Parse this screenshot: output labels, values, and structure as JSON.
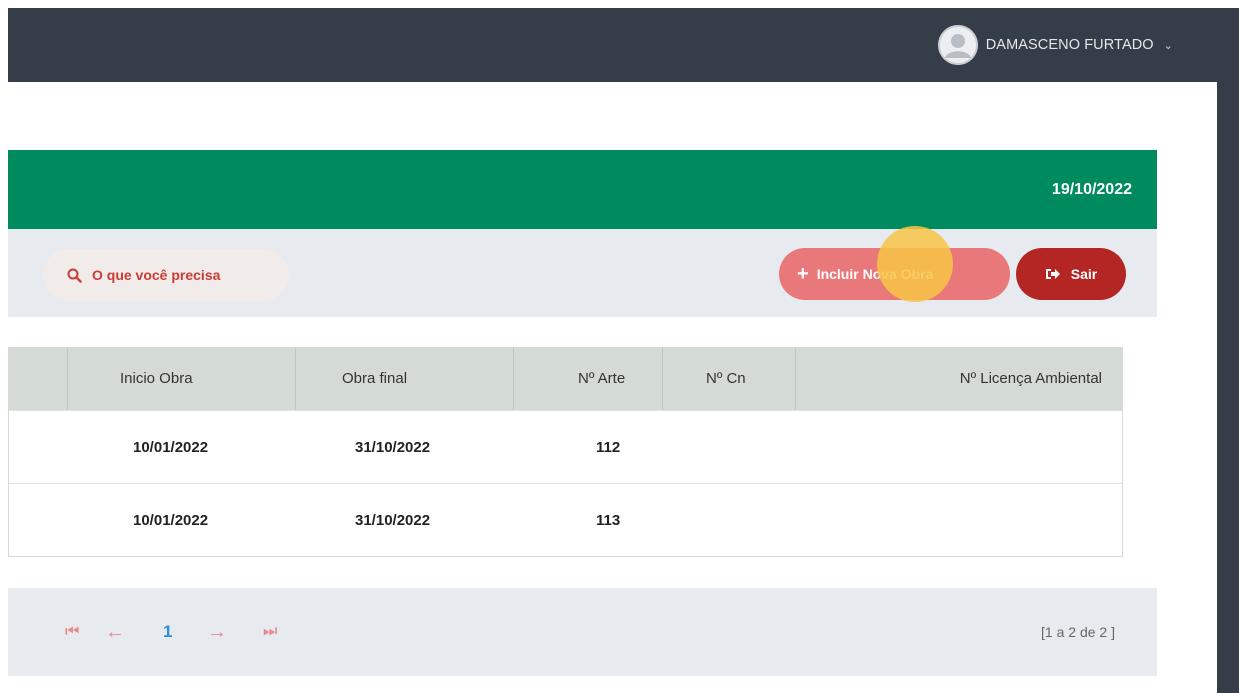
{
  "header": {
    "user_name": "DAMASCENO FURTADO",
    "user_menu_chevron": "⌄"
  },
  "banner": {
    "date": "19/10/2022",
    "color": "#008b5e"
  },
  "toolbar": {
    "search_label": "O que você precisa",
    "new_button_label": "Incluir Nova Obra",
    "exit_button_label": "Sair",
    "new_button_color": "#e9787a",
    "exit_button_color": "#b32623"
  },
  "table": {
    "headers": {
      "inicio": "Inicio Obra",
      "final": "Obra final",
      "arte": "Nº Arte",
      "cn": "Nº Cn",
      "licenca": "Nº Licença Ambiental"
    },
    "rows": [
      {
        "inicio": "10/01/2022",
        "final": "31/10/2022",
        "arte": "112",
        "cn": "",
        "licenca": ""
      },
      {
        "inicio": "10/01/2022",
        "final": "31/10/2022",
        "arte": "113",
        "cn": "",
        "licenca": ""
      }
    ]
  },
  "pagination": {
    "first": "⏮",
    "prev": "←",
    "current_page": "1",
    "next": "→",
    "last": "⏭",
    "count_text": "[1 a 2 de 2 ]"
  },
  "icons": [
    "user-avatar-icon",
    "chevron-down-icon",
    "search-icon",
    "plus-icon",
    "sign-out-icon",
    "first-page-icon",
    "prev-page-icon",
    "next-page-icon",
    "last-page-icon"
  ]
}
